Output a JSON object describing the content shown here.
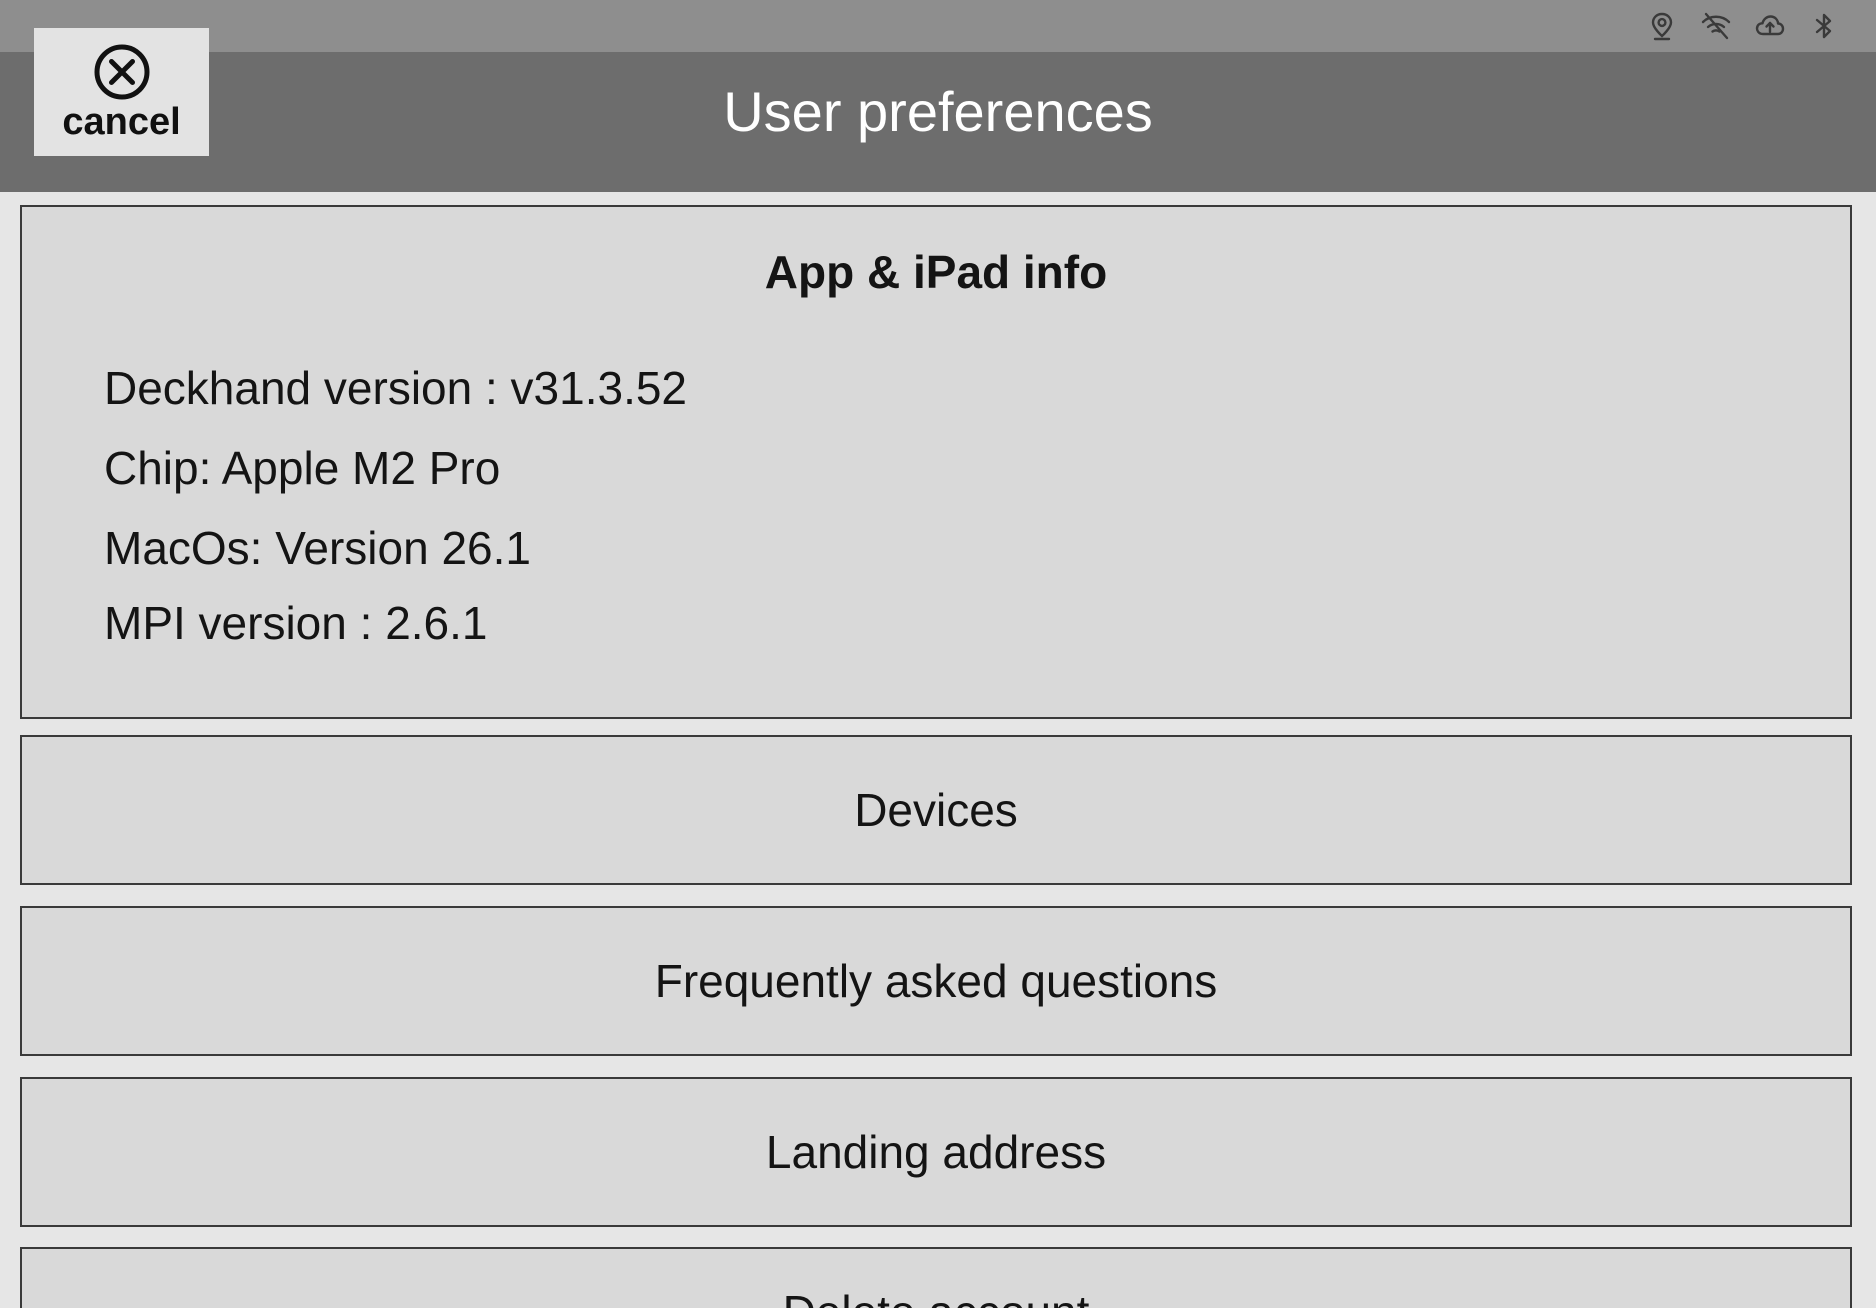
{
  "status_bar": {
    "icons": [
      "location-pin-icon",
      "wifi-off-icon",
      "cloud-upload-icon",
      "bluetooth-icon"
    ]
  },
  "header": {
    "title": "User preferences",
    "cancel_label": "cancel",
    "cancel_icon": "circle-x-icon",
    "background": "#6d6d6d"
  },
  "info_panel": {
    "title": "App & iPad info",
    "lines": [
      "Deckhand version : v31.3.52",
      "Chip: Apple M2 Pro",
      "MacOs: Version 26.1",
      "MPI version : 2.6.1"
    ]
  },
  "menu": [
    {
      "label": "Devices"
    },
    {
      "label": "Frequently asked questions"
    },
    {
      "label": "Landing address"
    },
    {
      "label": "Delete account"
    }
  ]
}
